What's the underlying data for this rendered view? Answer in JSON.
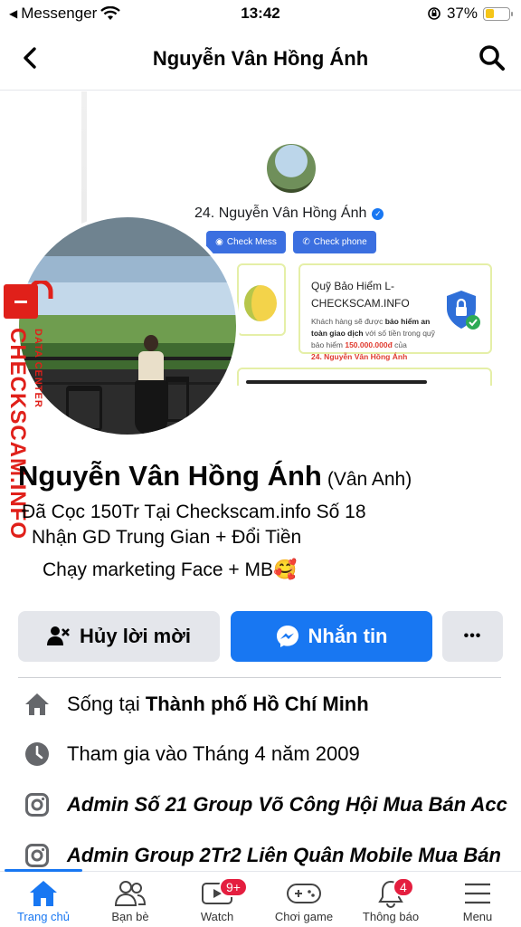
{
  "status_bar": {
    "back_app": "Messenger",
    "time": "13:42",
    "battery": "37%"
  },
  "header": {
    "title": "Nguyễn Vân Hồng Ánh"
  },
  "cover_card": {
    "name": "24. Nguyễn Vân Hồng Ánh",
    "check_mess": "Check Mess",
    "check_phone": "Check phone",
    "insurance_title": "Quỹ Bảo Hiểm L-CHECKSCAM.INFO",
    "insurance_text_1": "Khách hàng sẽ được ",
    "insurance_text_bold_1": "bảo hiểm an toàn giao dịch",
    "insurance_text_2": " với số tiền trong quỹ bảo hiểm ",
    "insurance_amount": "150.000.000đ",
    "insurance_text_3": " của",
    "insurance_name": "24. Nguyễn Vân Hồng Ánh"
  },
  "watermark": {
    "big": "CHECKSCAM.INFO",
    "small": "DATA CENTER"
  },
  "profile": {
    "name": "Nguyễn Vân Hồng Ánh",
    "alt_name": "(Vân Anh)",
    "bio_1": "Đã Cọc 150Tr Tại Checkscam.info Số 18",
    "bio_2": "Nhận GD Trung Gian + Đổi Tiền",
    "bio_3": "Chạy marketing Face + MB🥰"
  },
  "actions": {
    "cancel_request": "Hủy lời mời",
    "message": "Nhắn tin",
    "more": "•••"
  },
  "info": {
    "lives_prefix": "Sống tại ",
    "lives_city": "Thành phố Hồ Chí Minh",
    "joined": "Tham gia vào Tháng 4 năm 2009",
    "ig_1": "Admin Số 21 Group Võ Công Hội Mua Bán Acc",
    "ig_2": "Admin Group 2Tr2 Liên Quân Mobile Mua Bán"
  },
  "tabs": [
    {
      "label": "Trang chủ",
      "icon": "home-icon"
    },
    {
      "label": "Bạn bè",
      "icon": "friends-icon"
    },
    {
      "label": "Watch",
      "icon": "watch-icon",
      "badge": "9+"
    },
    {
      "label": "Chơi game",
      "icon": "gaming-icon"
    },
    {
      "label": "Thông báo",
      "icon": "bell-icon",
      "badge": "4"
    },
    {
      "label": "Menu",
      "icon": "menu-icon"
    }
  ],
  "colors": {
    "accent": "#1877f2",
    "watermark_red": "#e0201a",
    "badge_red": "#e41e3f"
  }
}
